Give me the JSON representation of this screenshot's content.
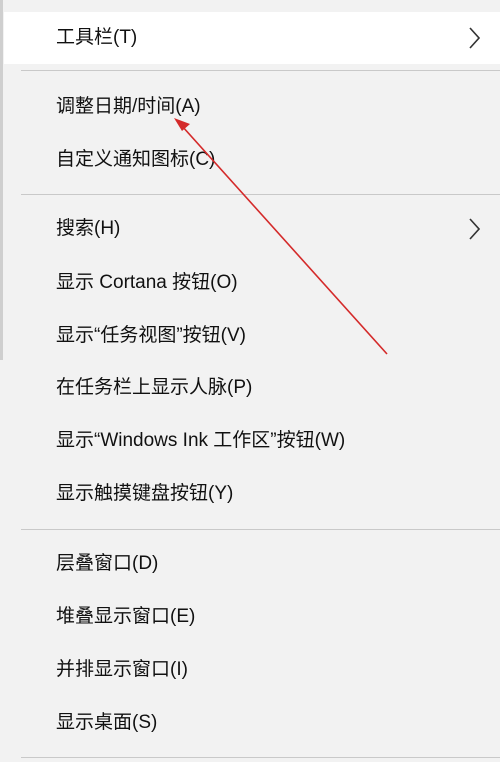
{
  "context_menu": {
    "items": [
      {
        "label": "工具栏(T)",
        "has_submenu": true
      },
      {
        "label": "调整日期/时间(A)",
        "has_submenu": false
      },
      {
        "label": "自定义通知图标(C)",
        "has_submenu": false
      },
      {
        "label": "搜索(H)",
        "has_submenu": true
      },
      {
        "label": "显示 Cortana 按钮(O)",
        "has_submenu": false
      },
      {
        "label": "显示“任务视图”按钮(V)",
        "has_submenu": false
      },
      {
        "label": "在任务栏上显示人脉(P)",
        "has_submenu": false
      },
      {
        "label": "显示“Windows Ink 工作区”按钮(W)",
        "has_submenu": false
      },
      {
        "label": "显示触摸键盘按钮(Y)",
        "has_submenu": false
      },
      {
        "label": "层叠窗口(D)",
        "has_submenu": false
      },
      {
        "label": "堆叠显示窗口(E)",
        "has_submenu": false
      },
      {
        "label": "并排显示窗口(I)",
        "has_submenu": false
      },
      {
        "label": "显示桌面(S)",
        "has_submenu": false
      }
    ],
    "submenu_icon": "chevron-right-icon",
    "hovered_item": "工具栏(T)"
  },
  "annotation": {
    "type": "arrow",
    "color": "#d42a2a",
    "points_to": "调整日期/时间(A)"
  },
  "colors": {
    "menu_background": "#f2f2f2",
    "hover_background": "#ffffff",
    "separator": "#c9c9c9",
    "text": "#111111"
  }
}
